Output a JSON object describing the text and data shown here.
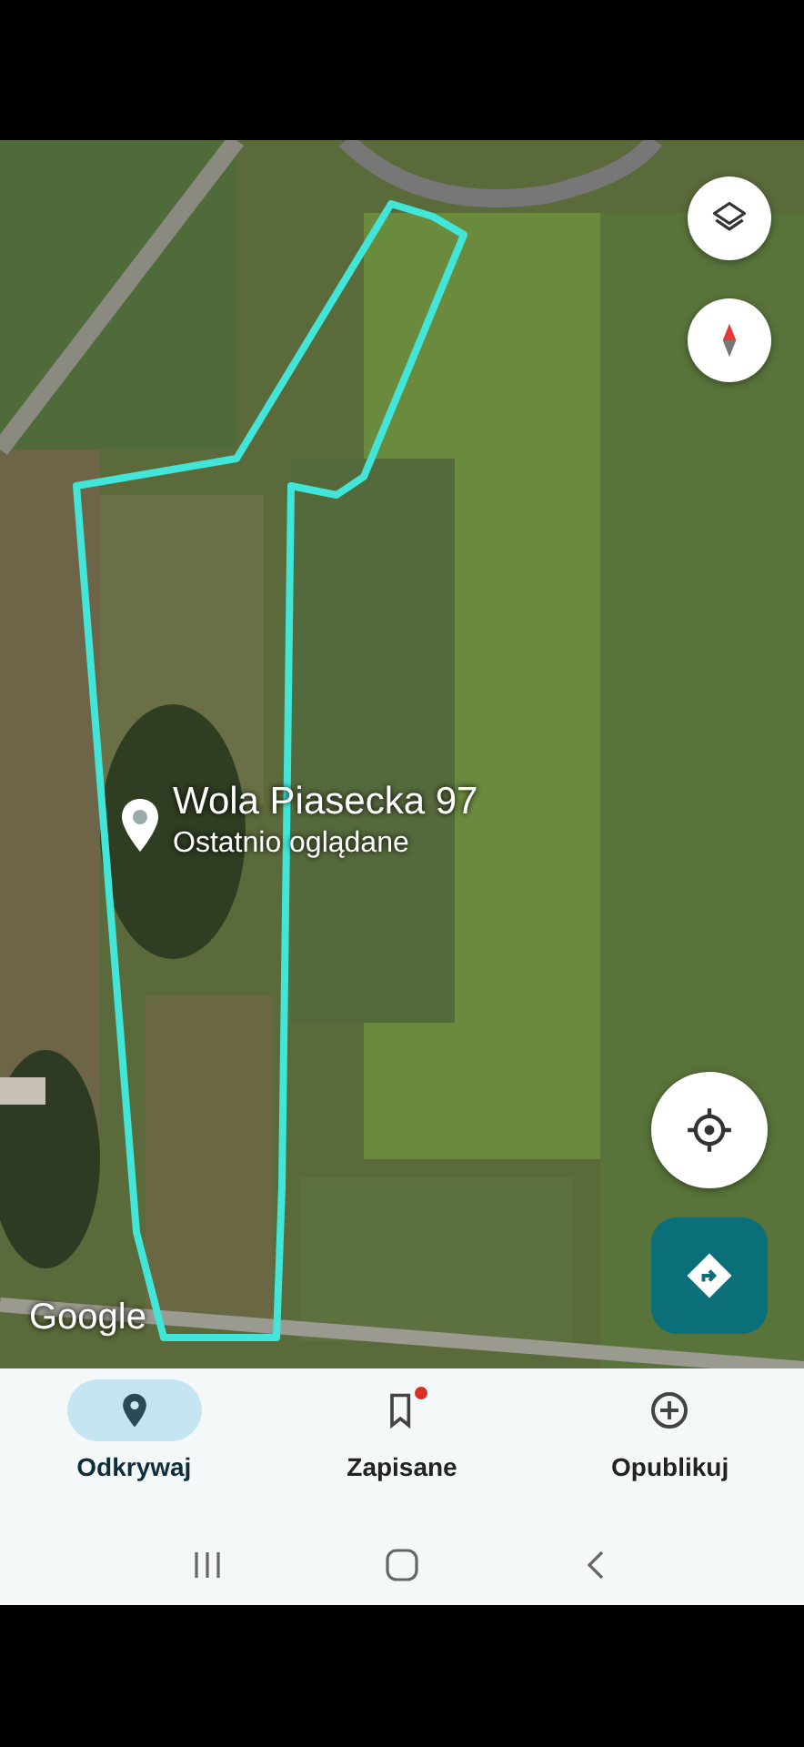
{
  "map": {
    "place": {
      "title": "Wola Piasecka 97",
      "subtitle": "Ostatnio oglądane"
    },
    "logo": "Google"
  },
  "nav": [
    {
      "label": "Odkrywaj",
      "selected": true,
      "badge": false
    },
    {
      "label": "Zapisane",
      "selected": false,
      "badge": true
    },
    {
      "label": "Opublikuj",
      "selected": false,
      "badge": false
    }
  ]
}
